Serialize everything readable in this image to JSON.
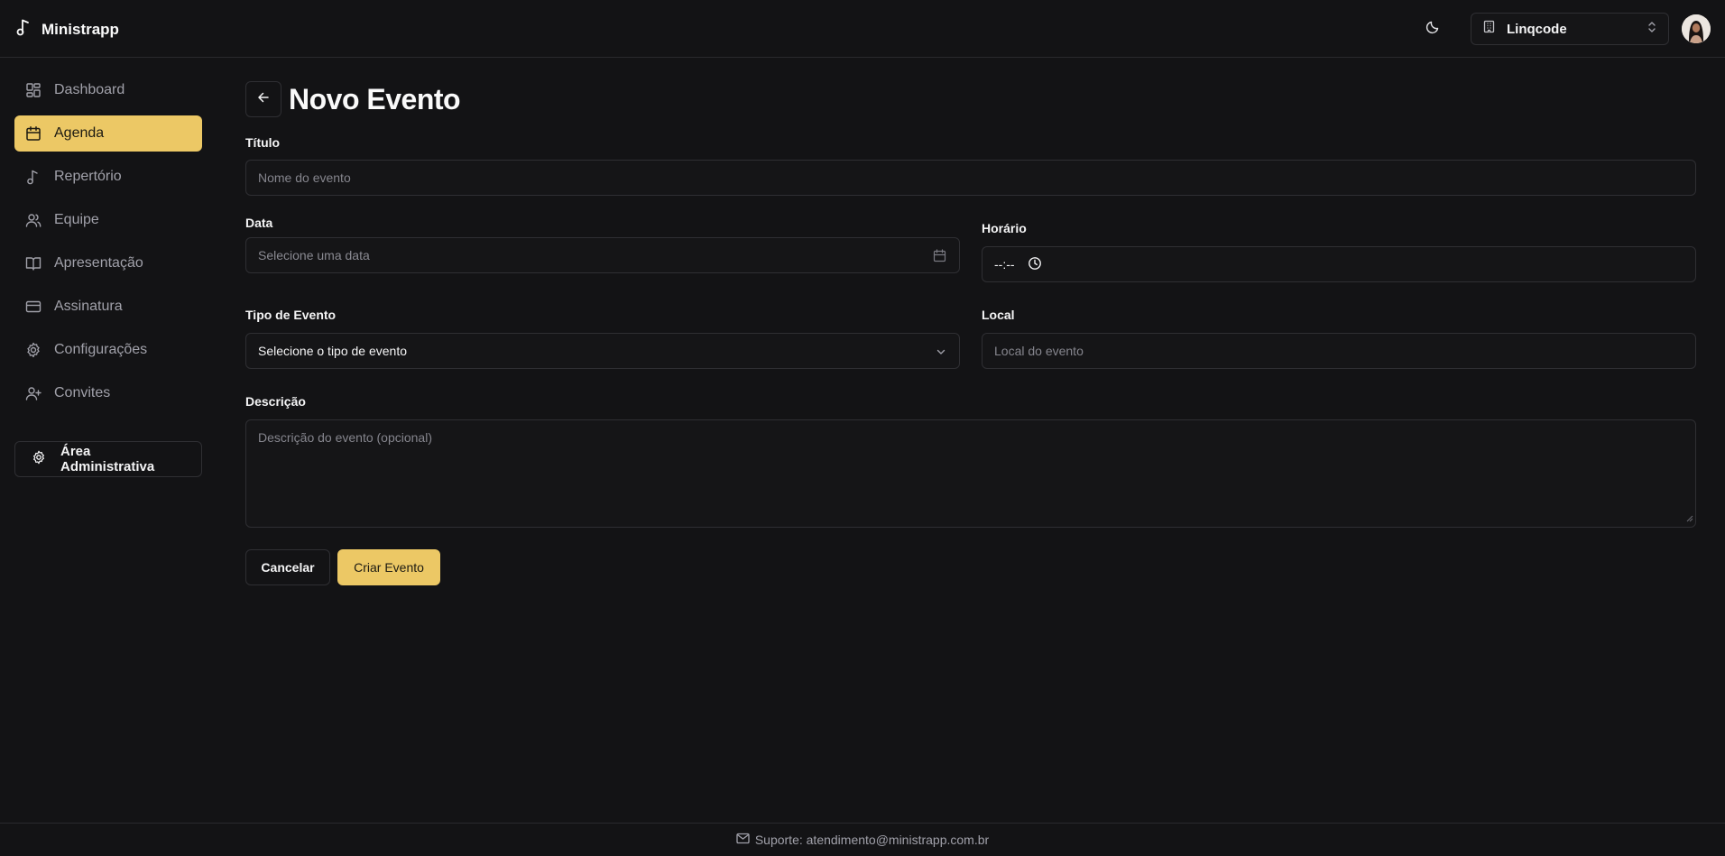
{
  "app": {
    "name": "Ministrapp",
    "logo_icon": "music-note-icon"
  },
  "header": {
    "theme_icon": "moon-icon",
    "org_select": {
      "icon": "building-icon",
      "value": "Linqcode",
      "chevron_icon": "chevrons-up-down-icon"
    },
    "avatar_icon": "user-avatar"
  },
  "sidebar": {
    "items": [
      {
        "label": "Dashboard",
        "icon": "dashboard-icon",
        "active": false
      },
      {
        "label": "Agenda",
        "icon": "calendar-icon",
        "active": true
      },
      {
        "label": "Repertório",
        "icon": "music-note-icon",
        "active": false
      },
      {
        "label": "Equipe",
        "icon": "users-icon",
        "active": false
      },
      {
        "label": "Apresentação",
        "icon": "book-open-icon",
        "active": false
      },
      {
        "label": "Assinatura",
        "icon": "credit-card-icon",
        "active": false
      },
      {
        "label": "Configurações",
        "icon": "gear-icon",
        "active": false
      },
      {
        "label": "Convites",
        "icon": "user-plus-icon",
        "active": false
      }
    ],
    "admin_button": {
      "label": "Área Administrativa",
      "icon": "gear-icon"
    }
  },
  "page": {
    "title": "Novo Evento",
    "back_icon": "arrow-left-icon"
  },
  "form": {
    "title": {
      "label": "Título",
      "placeholder": "Nome do evento",
      "value": ""
    },
    "date": {
      "label": "Data",
      "placeholder": "Selecione uma data",
      "icon": "calendar-icon"
    },
    "time": {
      "label": "Horário",
      "value": "--:--",
      "icon": "clock-icon"
    },
    "event_type": {
      "label": "Tipo de Evento",
      "value": "Selecione o tipo de evento",
      "icon": "chevron-down-icon"
    },
    "location": {
      "label": "Local",
      "placeholder": "Local do evento",
      "value": ""
    },
    "description": {
      "label": "Descrição",
      "placeholder": "Descrição do evento (opcional)"
    },
    "cancel_label": "Cancelar",
    "submit_label": "Criar Evento"
  },
  "footer": {
    "icon": "mail-icon",
    "text": "Suporte: atendimento@ministrapp.com.br"
  },
  "colors": {
    "background": "#131315",
    "accent": "#ecc865",
    "border": "#2f2f33",
    "muted_text": "#a1a1aa"
  }
}
